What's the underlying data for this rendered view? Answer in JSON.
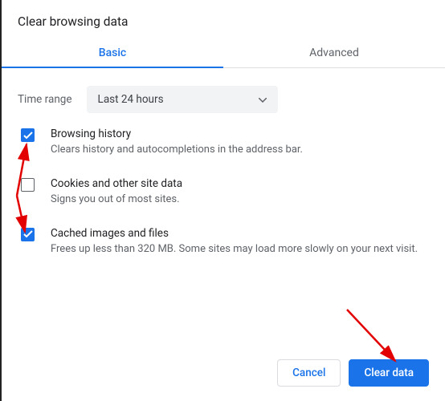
{
  "dialog": {
    "title": "Clear browsing data"
  },
  "tabs": {
    "basic": "Basic",
    "advanced": "Advanced"
  },
  "time": {
    "label": "Time range",
    "selected": "Last 24 hours"
  },
  "options": [
    {
      "checked": true,
      "title": "Browsing history",
      "desc": "Clears history and autocompletions in the address bar."
    },
    {
      "checked": false,
      "title": "Cookies and other site data",
      "desc": "Signs you out of most sites."
    },
    {
      "checked": true,
      "title": "Cached images and files",
      "desc": "Frees up less than 320 MB. Some sites may load more slowly on your next visit."
    }
  ],
  "buttons": {
    "cancel": "Cancel",
    "clear": "Clear data"
  }
}
